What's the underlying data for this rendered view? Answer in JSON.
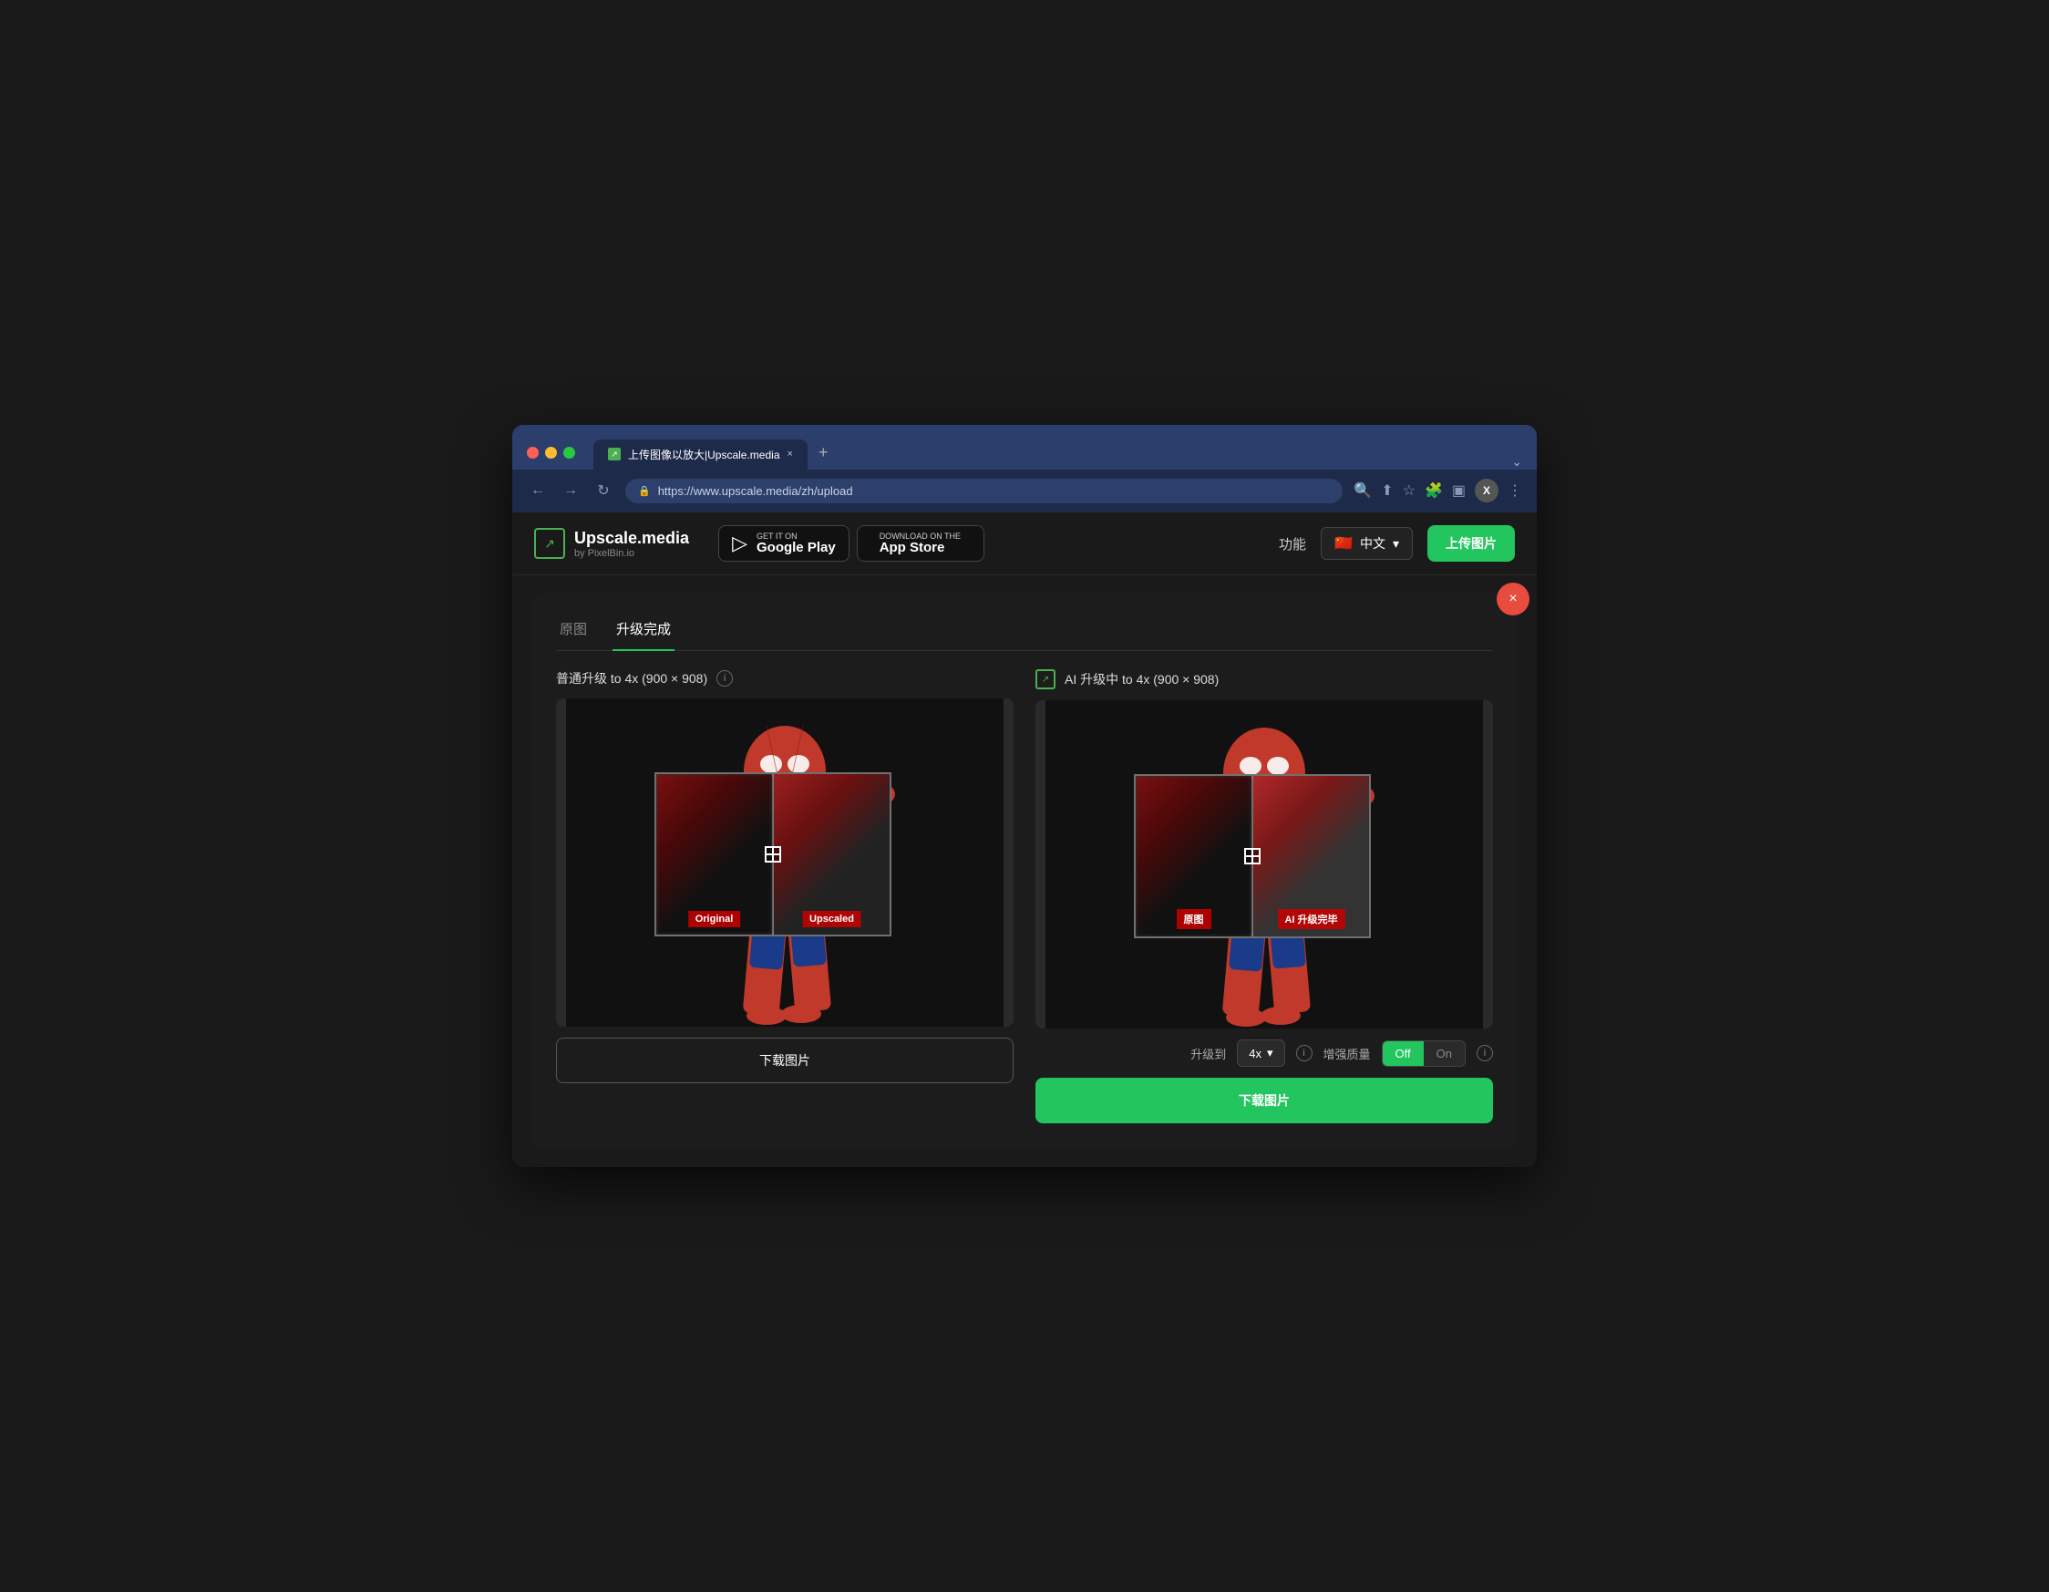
{
  "browser": {
    "traffic_lights": [
      "red",
      "yellow",
      "green"
    ],
    "tab_title": "上传图像以放大|Upscale.media",
    "tab_favicon": "↗",
    "new_tab_label": "+",
    "expand_icon": "⌄",
    "address": "https://www.upscale.media/zh/upload",
    "nav_back": "←",
    "nav_forward": "→",
    "nav_refresh": "↻"
  },
  "header": {
    "logo_icon": "↗",
    "logo_name": "Upscale.media",
    "logo_sub": "by PixelBin.io",
    "google_play_small": "GET IT ON",
    "google_play_big": "Google Play",
    "app_store_small": "Download on the",
    "app_store_big": "App Store",
    "nav_features": "功能",
    "lang_flag": "🇨🇳",
    "lang_label": "中文",
    "upload_btn": "上传图片"
  },
  "main": {
    "close_btn": "×",
    "tabs": [
      {
        "label": "原图",
        "active": false
      },
      {
        "label": "升级完成",
        "active": true
      }
    ],
    "left_panel": {
      "title": "普通升级 to 4x (900 × 908)",
      "download_btn": "下载图片",
      "left_label": "Original",
      "right_label": "Upscaled"
    },
    "right_panel": {
      "title": "AI 升级中 to 4x (900 × 908)",
      "upgrade_label": "升级到",
      "upgrade_value": "4x",
      "quality_label": "增强质量",
      "toggle_off": "Off",
      "toggle_on": "On",
      "download_btn": "下载图片",
      "left_label": "原图",
      "right_label": "AI 升级完毕"
    }
  }
}
